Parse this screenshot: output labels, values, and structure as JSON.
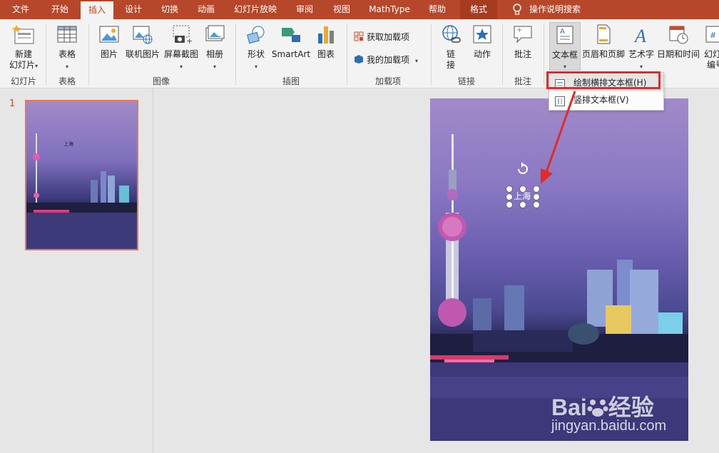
{
  "tabs": [
    {
      "label": "文件",
      "active": false
    },
    {
      "label": "开始",
      "active": false
    },
    {
      "label": "插入",
      "active": true
    },
    {
      "label": "设计",
      "active": false
    },
    {
      "label": "切换",
      "active": false
    },
    {
      "label": "动画",
      "active": false
    },
    {
      "label": "幻灯片放映",
      "active": false
    },
    {
      "label": "审阅",
      "active": false
    },
    {
      "label": "视图",
      "active": false
    },
    {
      "label": "MathType",
      "active": false
    },
    {
      "label": "帮助",
      "active": false
    },
    {
      "label": "格式",
      "active": false
    }
  ],
  "tell_me": "操作说明搜索",
  "ribbon": {
    "new_slide": "新建",
    "new_slide2": "幻灯片",
    "table": "表格",
    "picture": "图片",
    "online_picture": "联机图片",
    "screenshot": "屏幕截图",
    "album": "相册",
    "shapes": "形状",
    "smartart": "SmartArt",
    "chart": "图表",
    "get_addins": "获取加载项",
    "my_addins": "我的加载项",
    "link": "链",
    "link2": "接",
    "action": "动作",
    "comment": "批注",
    "textbox": "文本框",
    "header_footer": "页眉和页脚",
    "wordart": "艺术字",
    "datetime": "日期和时间",
    "slide_num": "幻灯",
    "slide_num2": "编号"
  },
  "groups": {
    "slides": "幻灯片",
    "tables": "表格",
    "images": "图像",
    "illustrations": "插图",
    "addins": "加载项",
    "links": "链接",
    "comments": "批注"
  },
  "textbox_menu": {
    "horizontal": "绘制横排文本框(H)",
    "vertical": "竖排文本框(V)"
  },
  "slide_panel": {
    "number": "1",
    "thumb_text": "上海"
  },
  "slide": {
    "textbox_text": "上海"
  },
  "watermark": {
    "brand": "Bai",
    "brand2": "经验",
    "url": "jingyan.baidu.com"
  },
  "colors": {
    "accent": "#b7472a",
    "highlight": "#e02b2b"
  }
}
